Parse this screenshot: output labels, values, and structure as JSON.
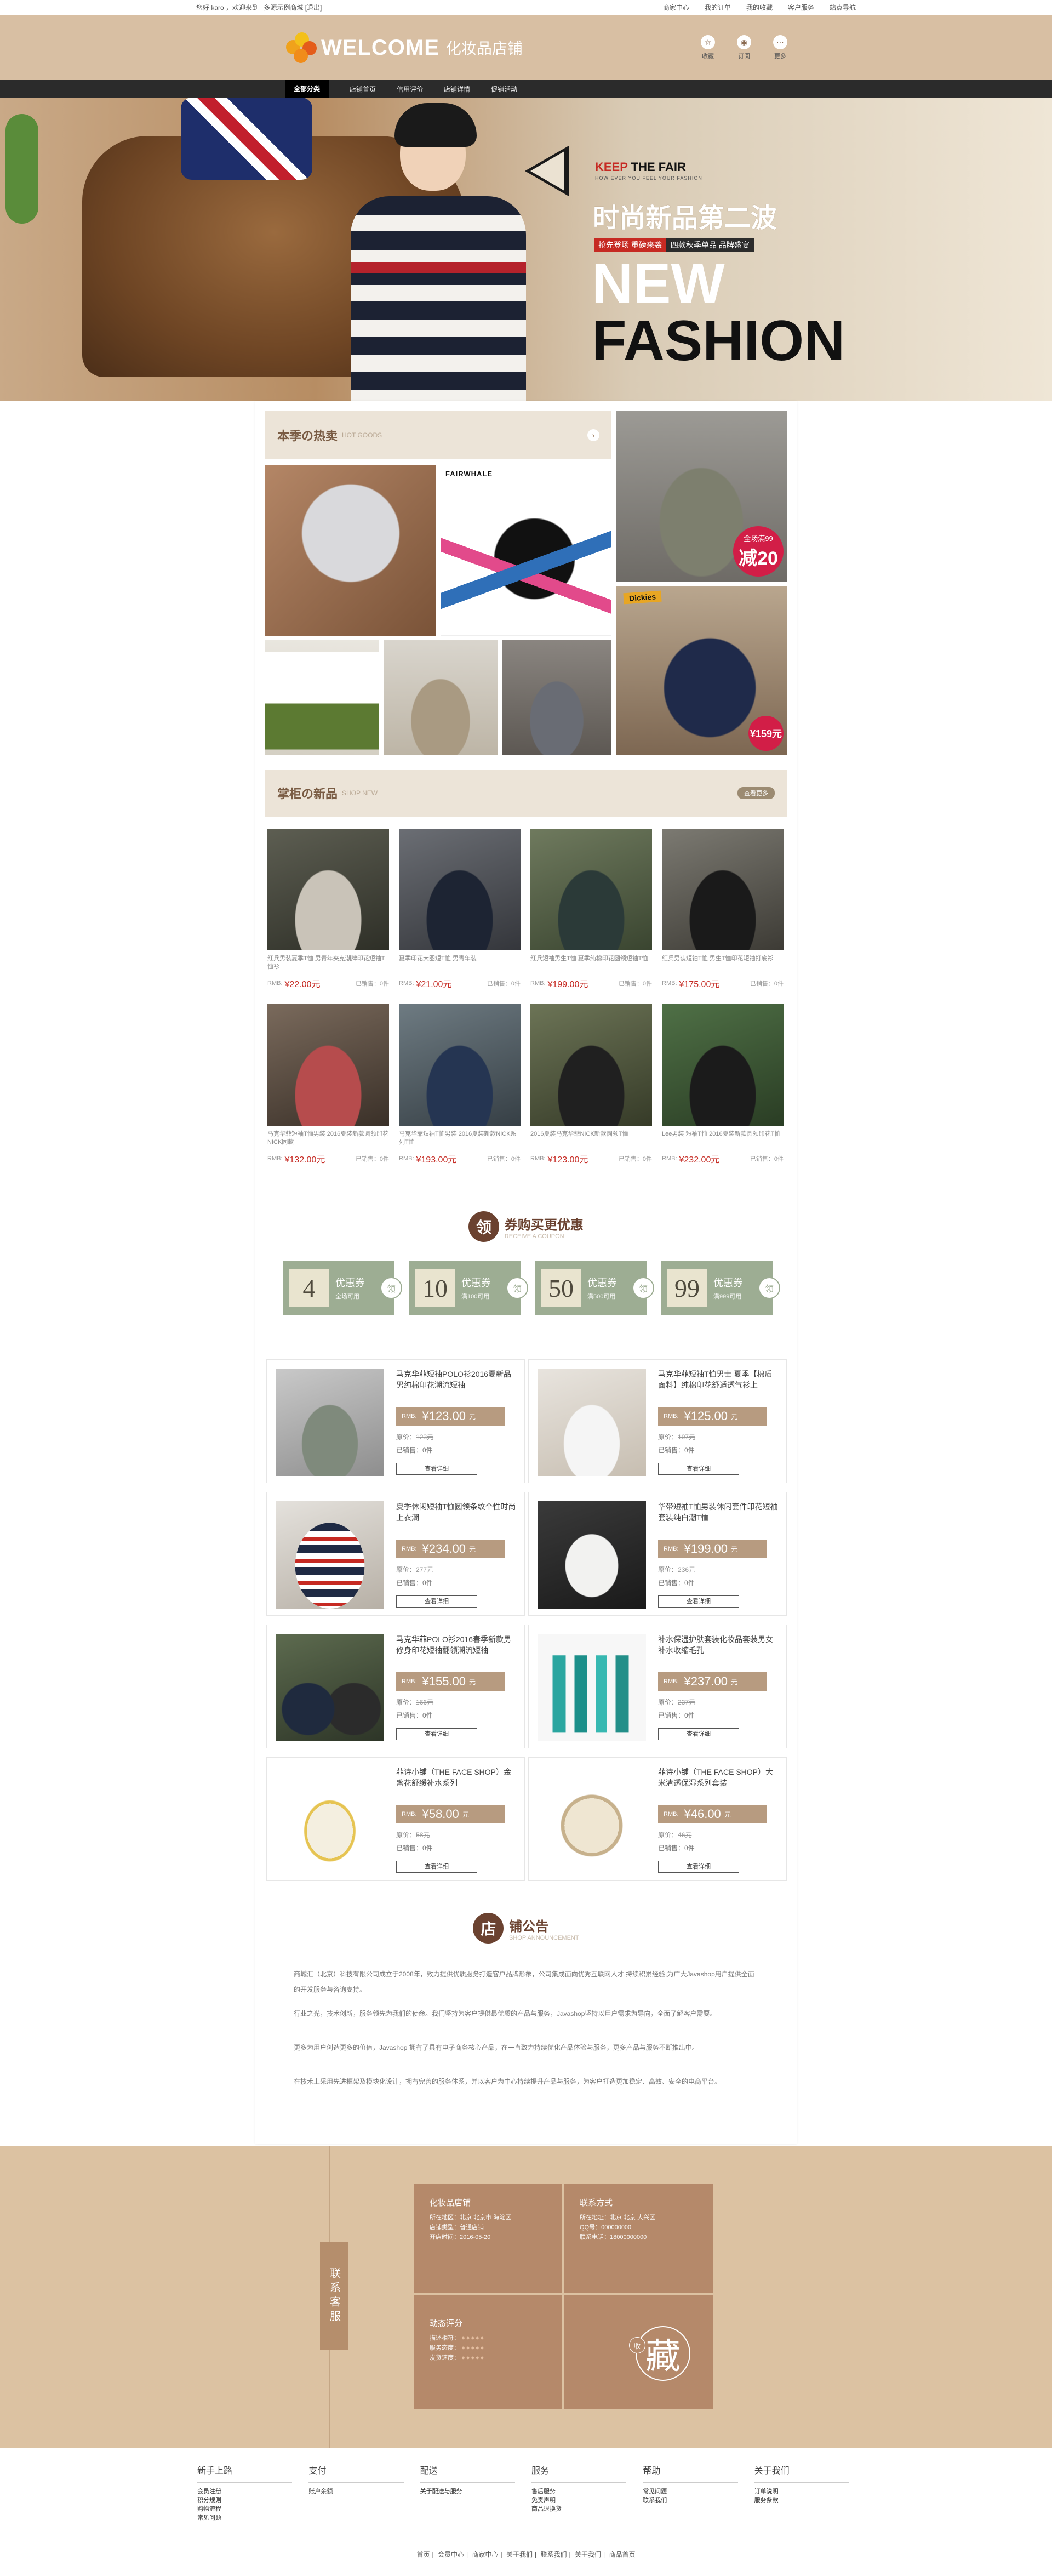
{
  "topbar": {
    "greeting": "您好 karo ，欢迎来到",
    "shop_link": "多源示例商城",
    "logout": "[退出]",
    "links": [
      "商家中心",
      "我的订单",
      "我的收藏",
      "客户服务",
      "站点导航"
    ]
  },
  "header": {
    "logo_word": "WELCOME",
    "logo_cn": "化妆品店铺",
    "icons": [
      {
        "icon": "star-icon",
        "label": "收藏"
      },
      {
        "icon": "rss-icon",
        "label": "订阅"
      },
      {
        "icon": "more-icon",
        "label": "更多"
      }
    ]
  },
  "nav": {
    "items": [
      "全部分类",
      "店铺首页",
      "信用评价",
      "店铺详情",
      "促销活动"
    ]
  },
  "banner": {
    "keep_red": "KEEP",
    "keep_black": "THE FAIR",
    "keep_sub": "HOW EVER YOU FEEL YOUR FASHION",
    "title": "时尚新品第二波",
    "tag_red": "抢先登场 重磅来袭",
    "tag_dark": "四款秋季单品 品牌盛宴",
    "line1": "NEW",
    "line2": "FASHION"
  },
  "hot": {
    "title": "本季の热卖",
    "en": "HOT GOODS",
    "more": "›",
    "fairwhale": "FAIRWHALE",
    "badge_a": "全场满99",
    "badge_b": "减20",
    "dickies": "Dickies",
    "price_badge": "¥159元"
  },
  "newprod": {
    "title": "掌柜の新品",
    "en": "SHOP NEW",
    "more": "查看更多",
    "items": [
      {
        "desc": "红兵男装夏季T恤 男青年夹克潮牌印花短袖T恤衫",
        "rmb": "RMB:",
        "price": "¥22.00元",
        "sold": "已销售：0件"
      },
      {
        "desc": "夏季印花大图短T恤 男青年装",
        "rmb": "RMB:",
        "price": "¥21.00元",
        "sold": "已销售：0件"
      },
      {
        "desc": "红兵短袖男生T恤 夏季纯棉印花圆领短袖T恤",
        "rmb": "RMB:",
        "price": "¥199.00元",
        "sold": "已销售：0件"
      },
      {
        "desc": "红兵男装短袖T恤 男生T恤印花短袖打底衫",
        "rmb": "RMB:",
        "price": "¥175.00元",
        "sold": "已销售：0件"
      },
      {
        "desc": "马克华菲短袖T恤男装 2016夏装新款圆领印花NICK同款",
        "rmb": "RMB:",
        "price": "¥132.00元",
        "sold": "已销售：0件"
      },
      {
        "desc": "马克华菲短袖T恤男装 2016夏装新款NICK系列T恤",
        "rmb": "RMB:",
        "price": "¥193.00元",
        "sold": "已销售：0件"
      },
      {
        "desc": "2016夏装马克华菲NICK新款圆领T恤",
        "rmb": "RMB:",
        "price": "¥123.00元",
        "sold": "已销售：0件"
      },
      {
        "desc": "Lee男装 短袖T恤 2016夏装新款圆领印花T恤",
        "rmb": "RMB:",
        "price": "¥232.00元",
        "sold": "已销售：0件"
      }
    ]
  },
  "coupon": {
    "icon": "领",
    "title": "券购买更优惠",
    "en": "RECEIVE A COUPON",
    "items": [
      {
        "num": "4",
        "a": "优惠券",
        "b": "全场可用",
        "ling": "领"
      },
      {
        "num": "10",
        "a": "优惠券",
        "b": "满100可用",
        "ling": "领"
      },
      {
        "num": "50",
        "a": "优惠券",
        "b": "满500可用",
        "ling": "领"
      },
      {
        "num": "99",
        "a": "优惠券",
        "b": "满999可用",
        "ling": "领"
      }
    ]
  },
  "list": {
    "items": [
      {
        "name": "马克华菲短袖POLO衫2016夏新品男纯棉印花潮流短袖",
        "rmb": "RMB:",
        "price": "¥123.00",
        "unit": "元",
        "orig_label": "原价：",
        "orig": "123元",
        "sold": "已销售：0件",
        "btn": "查看详细"
      },
      {
        "name": "马克华菲短袖T恤男士 夏季【棉质面料】纯棉印花舒适透气衫上",
        "rmb": "RMB:",
        "price": "¥125.00",
        "unit": "元",
        "orig_label": "原价：",
        "orig": "197元",
        "sold": "已销售：0件",
        "btn": "查看详细"
      },
      {
        "name": "夏季休闲短袖T恤圆领条纹个性时尚上衣潮",
        "rmb": "RMB:",
        "price": "¥234.00",
        "unit": "元",
        "orig_label": "原价：",
        "orig": "277元",
        "sold": "已销售：0件",
        "btn": "查看详细"
      },
      {
        "name": "华带短袖T恤男装休闲套件印花短袖套装纯白潮T恤",
        "rmb": "RMB:",
        "price": "¥199.00",
        "unit": "元",
        "orig_label": "原价：",
        "orig": "236元",
        "sold": "已销售：0件",
        "btn": "查看详细"
      },
      {
        "name": "马克华菲POLO衫2016春季新款男修身印花短袖翻领潮流短袖",
        "rmb": "RMB:",
        "price": "¥155.00",
        "unit": "元",
        "orig_label": "原价：",
        "orig": "166元",
        "sold": "已销售：0件",
        "btn": "查看详细"
      },
      {
        "name": "补水保湿护肤套装化妆品套装男女补水收缩毛孔",
        "rmb": "RMB:",
        "price": "¥237.00",
        "unit": "元",
        "orig_label": "原价：",
        "orig": "237元",
        "sold": "已销售：0件",
        "btn": "查看详细"
      },
      {
        "name": "菲诗小铺（THE FACE SHOP）金盏花舒缓补水系列",
        "rmb": "RMB:",
        "price": "¥58.00",
        "unit": "元",
        "orig_label": "原价：",
        "orig": "58元",
        "sold": "已销售：0件",
        "btn": "查看详细"
      },
      {
        "name": "菲诗小铺（THE FACE SHOP）大米清透保湿系列套装",
        "rmb": "RMB:",
        "price": "¥46.00",
        "unit": "元",
        "orig_label": "原价：",
        "orig": "46元",
        "sold": "已销售：0件",
        "btn": "查看详细"
      }
    ]
  },
  "notice": {
    "icon": "店",
    "title": "铺公告",
    "en": "SHOP ANNOUNCEMENT",
    "paragraphs": [
      "商城汇（北京）科技有限公司成立于2008年，致力提供优质服务打造客户品牌形象，公司集成面向优秀互联网人才,持续积累经验,为广大Javashop用户提供全面的开发服务与咨询支持。",
      "行业之光，技术创新，服务领先为我们的使命。我们坚持为客户提供最优质的产品与服务，Javashop坚持以用户需求为导向，全面了解客户需要。",
      "更多为用户创造更多的价值，Javashop 拥有了具有电子商务核心产品，在一直致力持续优化产品体验与服务，更多产品与服务不断推出中。",
      "在技术上采用先进框架及模块化设计，拥有完善的服务体系，并以客户为中心持续提升产品与服务，为客户打造更加稳定、高效、安全的电商平台。"
    ]
  },
  "footinfo": {
    "tab": "联系客服",
    "shop": {
      "h": "化妆品店铺",
      "lines": [
        "所在地区：北京 北京市 海淀区",
        "店铺类型：普通店铺",
        "开店时间：2016-05-20"
      ]
    },
    "contact": {
      "h": "联系方式",
      "lines": [
        "所在地址：北京 北京 大兴区",
        "QQ号：000000000",
        "联系电话：18000000000"
      ]
    },
    "rating": {
      "h": "动态评分",
      "lines": [
        "描述相符：",
        "服务态度：",
        "发货速度："
      ],
      "dots": "●●●●●"
    },
    "fav": {
      "label": "藏",
      "small": "收"
    }
  },
  "links": {
    "cols": [
      {
        "h": "新手上路",
        "l": [
          "会员注册",
          "积分规则",
          "购物流程",
          "常见问题"
        ]
      },
      {
        "h": "支付",
        "l": [
          "账户余额"
        ]
      },
      {
        "h": "配送",
        "l": [
          "关于配送与服务"
        ]
      },
      {
        "h": "服务",
        "l": [
          "售后服务",
          "免责声明",
          "商品退换货"
        ]
      },
      {
        "h": "帮助",
        "l": [
          "常见问题",
          "联系我们"
        ]
      },
      {
        "h": "关于我们",
        "l": [
          "订单说明",
          "服务条款"
        ]
      }
    ],
    "copy": [
      "首页",
      "会员中心",
      "商家中心",
      "关于我们",
      "联系我们",
      "关于我们",
      "商品首页"
    ]
  }
}
